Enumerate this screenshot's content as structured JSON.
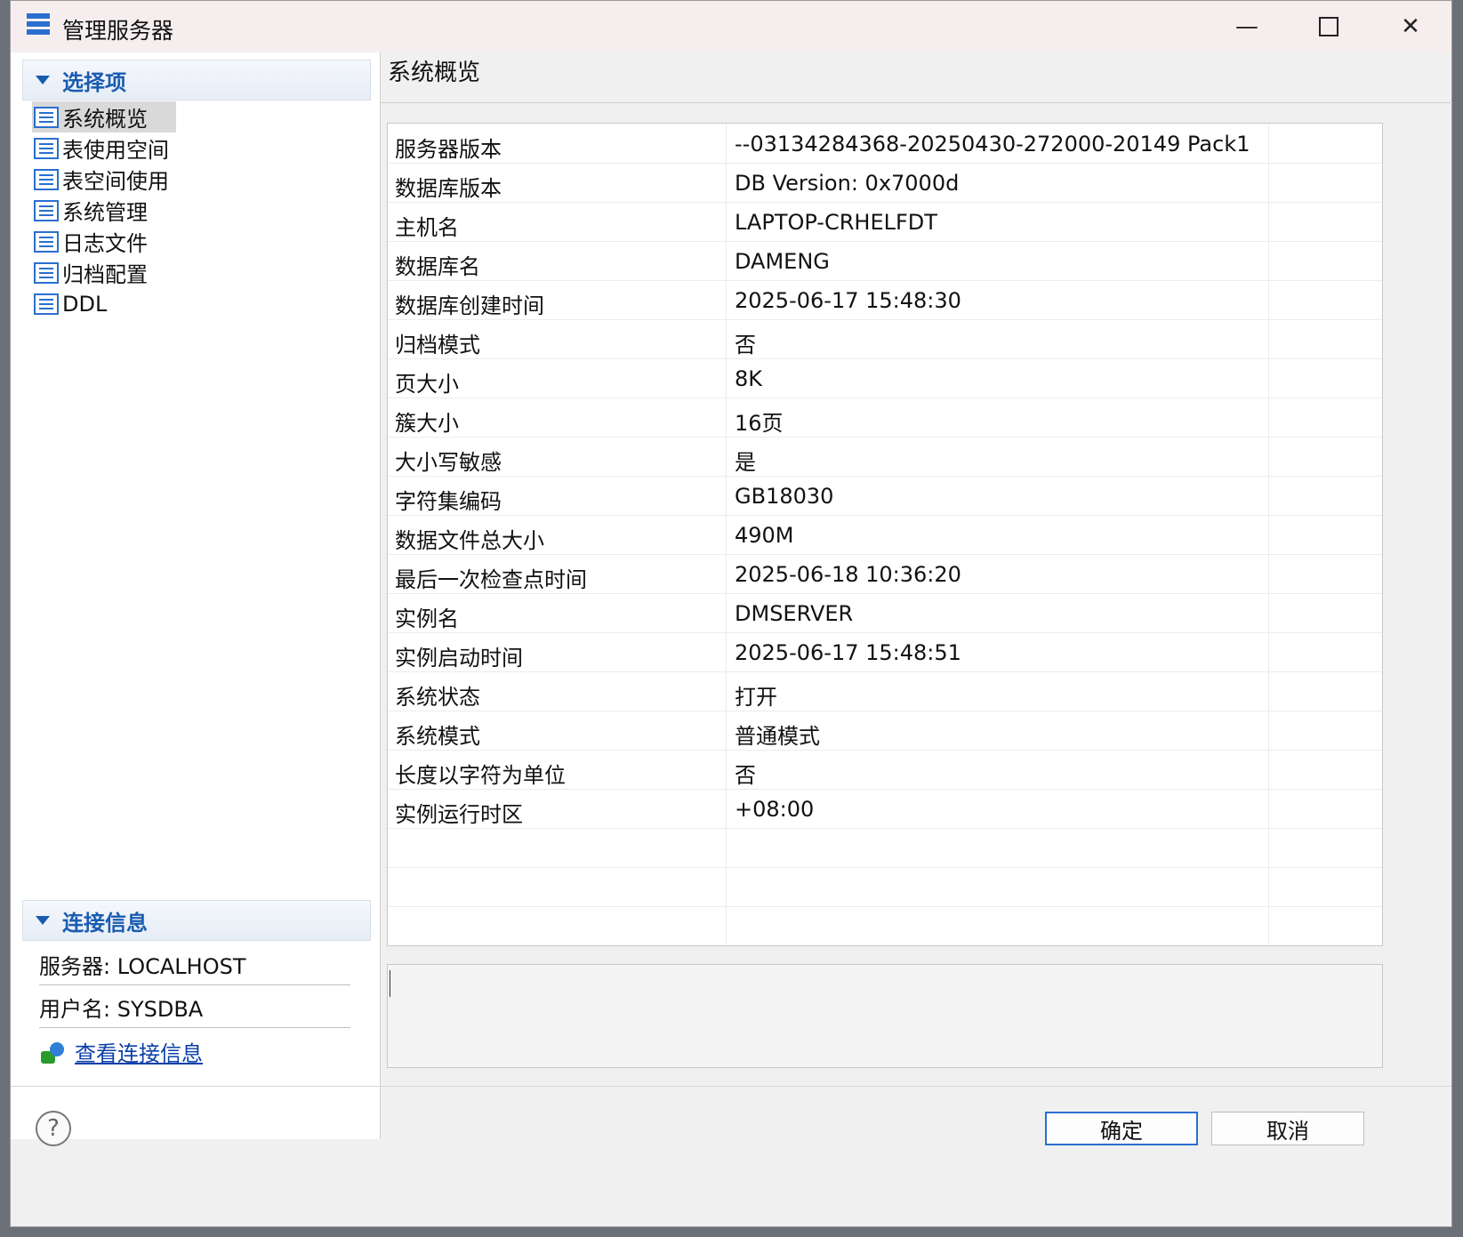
{
  "window": {
    "title": "管理服务器"
  },
  "left": {
    "section_select": "选择项",
    "nav": [
      "系统概览",
      "表使用空间",
      "表空间使用",
      "系统管理",
      "日志文件",
      "归档配置",
      "DDL"
    ],
    "section_conn": "连接信息",
    "server_label": "服务器: LOCALHOST",
    "user_label": "用户名: SYSDBA",
    "view_conn_link": "查看连接信息"
  },
  "right": {
    "title": "系统概览",
    "rows": [
      {
        "k": "服务器版本",
        "v": "--03134284368-20250430-272000-20149 Pack1"
      },
      {
        "k": "数据库版本",
        "v": "DB Version: 0x7000d"
      },
      {
        "k": "主机名",
        "v": "LAPTOP-CRHELFDT"
      },
      {
        "k": "数据库名",
        "v": "DAMENG"
      },
      {
        "k": "数据库创建时间",
        "v": "2025-06-17 15:48:30"
      },
      {
        "k": "归档模式",
        "v": "否"
      },
      {
        "k": "页大小",
        "v": "8K"
      },
      {
        "k": "簇大小",
        "v": "16页"
      },
      {
        "k": "大小写敏感",
        "v": "是"
      },
      {
        "k": "字符集编码",
        "v": "GB18030"
      },
      {
        "k": "数据文件总大小",
        "v": "490M"
      },
      {
        "k": "最后一次检查点时间",
        "v": "2025-06-18 10:36:20"
      },
      {
        "k": "实例名",
        "v": "DMSERVER"
      },
      {
        "k": "实例启动时间",
        "v": "2025-06-17 15:48:51"
      },
      {
        "k": "系统状态",
        "v": "打开"
      },
      {
        "k": "系统模式",
        "v": "普通模式"
      },
      {
        "k": "长度以字符为单位",
        "v": "否"
      },
      {
        "k": "实例运行时区",
        "v": "+08:00"
      }
    ]
  },
  "buttons": {
    "ok": "确定",
    "cancel": "取消",
    "help": "?"
  },
  "icons": {
    "minimize": "—",
    "close": "✕"
  },
  "colors": {
    "accent": "#2a6fd0",
    "link": "#0b3fa8"
  }
}
